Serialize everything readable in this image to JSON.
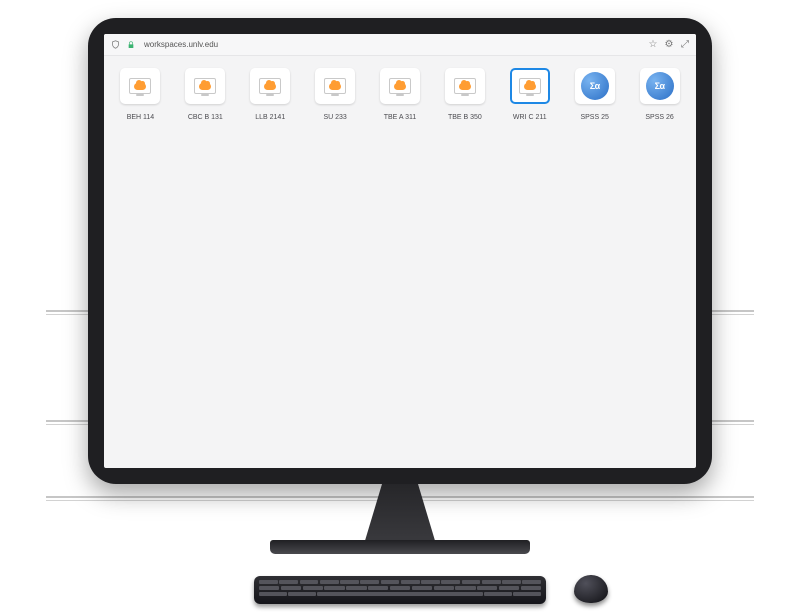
{
  "toolbar": {
    "address": "workspaces.unlv.edu"
  },
  "workspaces": [
    {
      "id": "BEH 114",
      "label": "BEH 114",
      "icon": "cloud-monitor",
      "selected": false
    },
    {
      "id": "CBC B 131",
      "label": "CBC B 131",
      "icon": "cloud-monitor",
      "selected": false
    },
    {
      "id": "LLB 2141",
      "label": "LLB 2141",
      "icon": "cloud-monitor",
      "selected": false
    },
    {
      "id": "SU 233",
      "label": "SU 233",
      "icon": "cloud-monitor",
      "selected": false
    },
    {
      "id": "TBE A 311",
      "label": "TBE A 311",
      "icon": "cloud-monitor",
      "selected": false
    },
    {
      "id": "TBE B 350",
      "label": "TBE B 350",
      "icon": "cloud-monitor",
      "selected": false
    },
    {
      "id": "WRI C 211",
      "label": "WRI C 211",
      "icon": "cloud-monitor",
      "selected": true
    },
    {
      "id": "SPSS 25",
      "label": "SPSS 25",
      "icon": "spss",
      "selected": false
    },
    {
      "id": "SPSS 26",
      "label": "SPSS 26",
      "icon": "spss",
      "selected": false
    }
  ],
  "spss_glyph": "Σα"
}
